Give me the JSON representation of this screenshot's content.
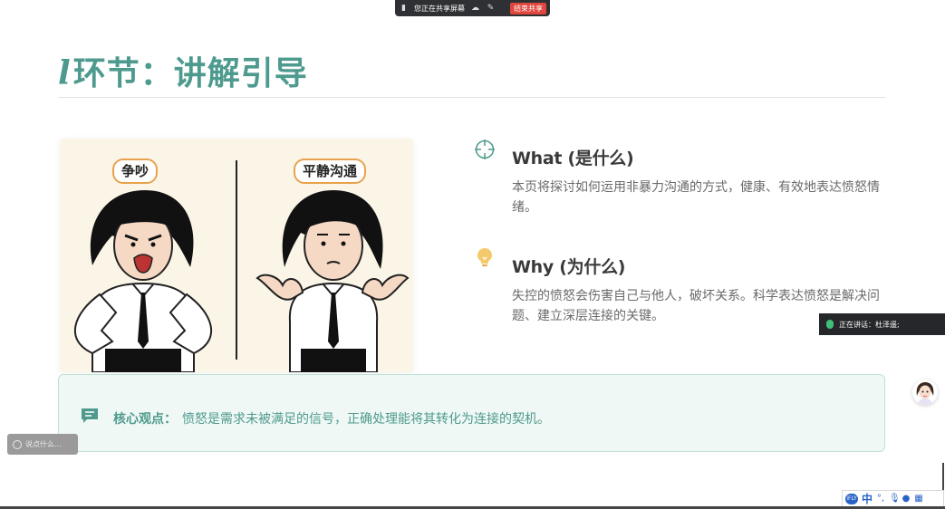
{
  "sharebar": {
    "status": "您正在共享屏幕",
    "stop_label": "结束共享"
  },
  "slide": {
    "title_prefix": "l",
    "title": "环节：讲解引导",
    "illustration": {
      "left_label": "争吵",
      "right_label": "平静沟通"
    },
    "what": {
      "heading": "What (是什么)",
      "body": "本页将探讨如何运用非暴力沟通的方式，健康、有效地表达愤怒情绪。",
      "icon": "target-icon"
    },
    "why": {
      "heading": "Why (为什么)",
      "body": "失控的愤怒会伤害自己与他人，破坏关系。科学表达愤怒是解决问题、建立深层连接的关键。",
      "icon": "lightbulb-icon"
    },
    "key_point": {
      "label": "核心观点：",
      "text": "愤怒是需求未被满足的信号，正确处理能将其转化为连接的契机。"
    }
  },
  "meeting": {
    "speaking": "正在讲话：杜泽遥;",
    "comment_placeholder": "说点什么..."
  },
  "ime": {
    "mode": "中",
    "logo": "iFLY"
  },
  "colors": {
    "accent": "#4e9a8e",
    "key_bg": "#eff8f5",
    "pill_border": "#e8a24c"
  }
}
